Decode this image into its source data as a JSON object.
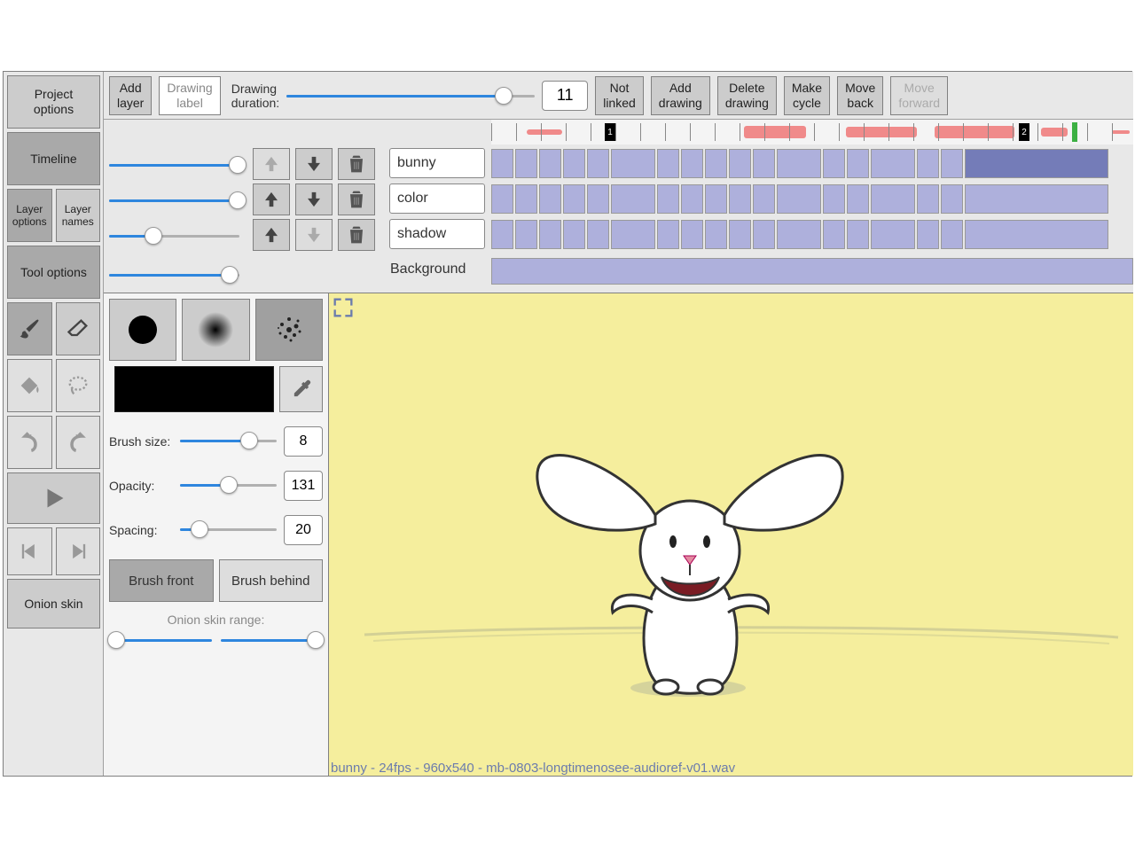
{
  "sidebar": {
    "project_options": "Project\noptions",
    "timeline": "Timeline",
    "layer_options": "Layer\noptions",
    "layer_names": "Layer\nnames",
    "tool_options": "Tool options",
    "onion_skin": "Onion skin"
  },
  "topbar": {
    "add_layer": "Add\nlayer",
    "drawing_label": "Drawing\nlabel",
    "drawing_duration": "Drawing\nduration:",
    "drawing_duration_value": "11",
    "not_linked": "Not\nlinked",
    "add_drawing": "Add\ndrawing",
    "delete_drawing": "Delete\ndrawing",
    "make_cycle": "Make\ncycle",
    "move_back": "Move\nback",
    "move_forward": "Move\nforward"
  },
  "layers": [
    {
      "name": "bunny",
      "slider": 100,
      "up_disabled": true,
      "down_disabled": false,
      "big_last": true
    },
    {
      "name": "color",
      "slider": 100,
      "up_disabled": false,
      "down_disabled": false,
      "big_last": false
    },
    {
      "name": "shadow",
      "slider": 35,
      "up_disabled": false,
      "down_disabled": true,
      "big_last": false
    }
  ],
  "background": {
    "label": "Background",
    "slider": 90
  },
  "audio": {
    "markers": [
      1,
      2
    ]
  },
  "brush": {
    "size_label": "Brush size:",
    "size": "8",
    "opacity_label": "Opacity:",
    "opacity": "131",
    "spacing_label": "Spacing:",
    "spacing": "20",
    "front": "Brush front",
    "behind": "Brush behind",
    "selected_swatch": 2
  },
  "onion": {
    "label": "Onion skin range:"
  },
  "status": "bunny - 24fps - 960x540 - mb-0803-longtimenosee-audioref-v01.wav"
}
